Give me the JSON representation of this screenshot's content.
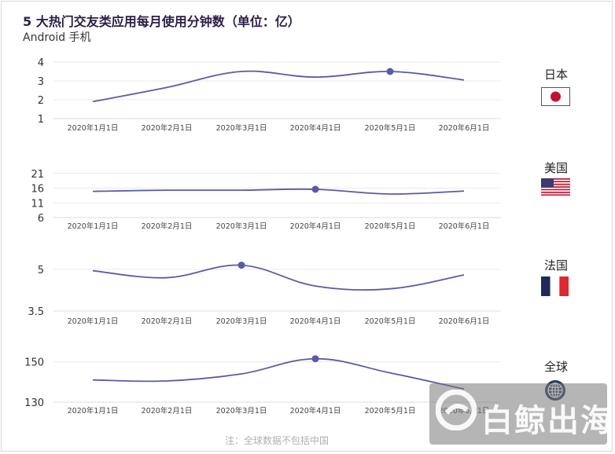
{
  "title": "5 大热门交友类应用每月使用分钟数（单位：亿）",
  "subtitle": "Android 手机",
  "footnote": "注：全球数据不包括中国",
  "watermark": "白鲸出海",
  "colors": {
    "line": "#5b5aa8",
    "grid": "#e9e9e9",
    "axis": "#666666"
  },
  "chart_data": [
    {
      "type": "line",
      "country": "日本",
      "flag": "japan-flag",
      "x": [
        "2020年1月1日",
        "2020年2月1日",
        "2020年3月1日",
        "2020年4月1日",
        "2020年5月1日",
        "2020年6月1日"
      ],
      "values": [
        1.9,
        2.65,
        3.5,
        3.2,
        3.5,
        3.05
      ],
      "highlight_index": 4,
      "yticks": [
        1,
        2,
        3,
        4
      ],
      "ylim": [
        1,
        4
      ]
    },
    {
      "type": "line",
      "country": "美国",
      "flag": "us-flag",
      "x": [
        "2020年1月1日",
        "2020年2月1日",
        "2020年3月1日",
        "2020年4月1日",
        "2020年5月1日",
        "2020年6月1日"
      ],
      "values": [
        14.9,
        15.3,
        15.3,
        15.6,
        14.0,
        15.0
      ],
      "highlight_index": 3,
      "yticks": [
        6,
        11,
        16,
        21
      ],
      "ylim": [
        6,
        22
      ]
    },
    {
      "type": "line",
      "country": "法国",
      "flag": "france-flag",
      "x": [
        "2020年1月1日",
        "2020年2月1日",
        "2020年3月1日",
        "2020年4月1日",
        "2020年5月1日",
        "2020年6月1日"
      ],
      "values": [
        4.95,
        4.7,
        5.15,
        4.4,
        4.3,
        4.8
      ],
      "highlight_index": 2,
      "yticks": [
        3.5,
        5.0
      ],
      "ylim": [
        3.5,
        5.45
      ]
    },
    {
      "type": "line",
      "country": "全球",
      "flag": "globe-icon",
      "x": [
        "2020年1月1日",
        "2020年2月1日",
        "2020年3月1日",
        "2020年4月1日",
        "2020年5月1日",
        "2020年6月1日"
      ],
      "values": [
        141,
        140.5,
        144,
        151.5,
        144.5,
        136.5
      ],
      "highlight_index": 3,
      "yticks": [
        130,
        150
      ],
      "ylim": [
        130,
        158
      ]
    }
  ]
}
